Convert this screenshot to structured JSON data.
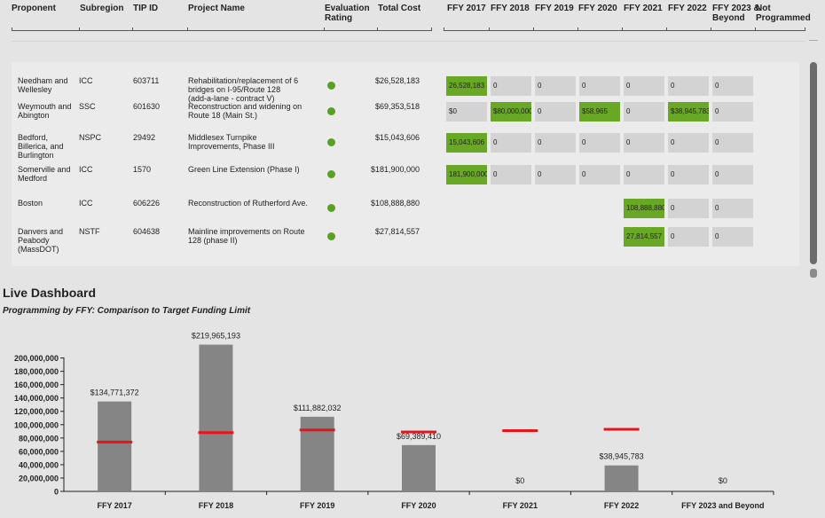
{
  "table": {
    "headers": {
      "proponent": "Proponent",
      "subregion": "Subregion",
      "tip_id": "TIP ID",
      "project_name": "Project Name",
      "evaluation_rating": [
        "Evaluation",
        "Rating"
      ],
      "total_cost": "Total Cost",
      "ffy2017": "FFY 2017",
      "ffy2018": "FFY 2018",
      "ffy2019": "FFY 2019",
      "ffy2020": "FFY 2020",
      "ffy2021": "FFY 2021",
      "ffy2022": "FFY 2022",
      "ffy2023": [
        "FFY 2023 &",
        "Beyond"
      ],
      "not_programmed": [
        "Not",
        "Programmed"
      ]
    },
    "rows": [
      {
        "proponent": [
          "Needham and",
          "Wellesley"
        ],
        "subregion": "ICC",
        "tip_id": "603711",
        "project_name": [
          "Rehabilitation/replacement of 6",
          "bridges on I-95/Route 128",
          "(add-a-lane - contract V)"
        ],
        "total_cost": "$26,528,183",
        "values": [
          "26,528,183",
          "0",
          "0",
          "0",
          "0",
          "0",
          "0"
        ],
        "green": [
          0
        ]
      },
      {
        "proponent": [
          "Weymouth and",
          "Abington"
        ],
        "subregion": "SSC",
        "tip_id": "601630",
        "project_name": [
          "Reconstruction and widening on",
          "Route 18 (Main St.)"
        ],
        "total_cost": "$69,353,518",
        "values": [
          "$0",
          "$80,000,000",
          "0",
          "$58,965",
          "0",
          "$38,945,783",
          "0"
        ],
        "green": [
          1,
          3,
          5
        ]
      },
      {
        "proponent": [
          "Bedford,",
          "Billerica, and",
          "Burlington"
        ],
        "subregion": "NSPC",
        "tip_id": "29492",
        "project_name": [
          "Middlesex Turnpike",
          "Improvements, Phase III"
        ],
        "total_cost": "$15,043,606",
        "values": [
          "15,043,606",
          "0",
          "0",
          "0",
          "0",
          "0",
          "0"
        ],
        "green": [
          0
        ]
      },
      {
        "proponent": [
          "Somerville and",
          "Medford"
        ],
        "subregion": "ICC",
        "tip_id": "1570",
        "project_name": [
          "Green Line Extension (Phase I)"
        ],
        "total_cost": "$181,900,000",
        "values": [
          "181,900,000",
          "0",
          "0",
          "0",
          "0",
          "0",
          "0"
        ],
        "green": [
          0
        ]
      },
      {
        "proponent": [
          "Boston"
        ],
        "subregion": "ICC",
        "tip_id": "606226",
        "project_name": [
          "Reconstruction of Rutherford Ave."
        ],
        "total_cost": "$108,888,880",
        "values": [
          "",
          "",
          "",
          "",
          "108,888,880",
          "0",
          "0"
        ],
        "green": [
          4
        ]
      },
      {
        "proponent": [
          "Danvers and",
          "Peabody",
          "(MassDOT)"
        ],
        "subregion": "NSTF",
        "tip_id": "604638",
        "project_name": [
          "Mainline improvements on Route",
          "128 (phase II)"
        ],
        "total_cost": "$27,814,557",
        "values": [
          "",
          "",
          "",
          "",
          "27,814,557",
          "0",
          "0"
        ],
        "green": [
          4
        ]
      }
    ]
  },
  "dashboard": {
    "title": "Live Dashboard",
    "subtitle": "Programming by FFY: Comparison to Target Funding Limit"
  },
  "colors": {
    "bar": "#858585",
    "target": "#e8141a",
    "rating_dot": "#5aa021",
    "green_cell": "#69a824"
  },
  "chart_data": {
    "type": "bar",
    "categories": [
      "FFY 2017",
      "FFY 2018",
      "FFY 2019",
      "FFY 2020",
      "FFY 2021",
      "FFY 2022",
      "FFY 2023 and Beyond"
    ],
    "values": [
      134771372,
      219965193,
      111882032,
      69389410,
      0,
      38945783,
      0
    ],
    "value_labels": [
      "$134,771,372",
      "$219,965,193",
      "$111,882,032",
      "$69,389,410",
      "$0",
      "$38,945,783",
      "$0"
    ],
    "targets": [
      74000000,
      88000000,
      92000000,
      89000000,
      91000000,
      93000000,
      null
    ],
    "yticks": [
      "200,000,000",
      "180,000,000",
      "160,000,000",
      "140,000,000",
      "120,000,000",
      "100,000,000",
      "80,000,000",
      "60,000,000",
      "40,000,000",
      "20,000,000",
      "0"
    ],
    "ylim": [
      0,
      230000000
    ],
    "xlabel": "",
    "ylabel": ""
  }
}
